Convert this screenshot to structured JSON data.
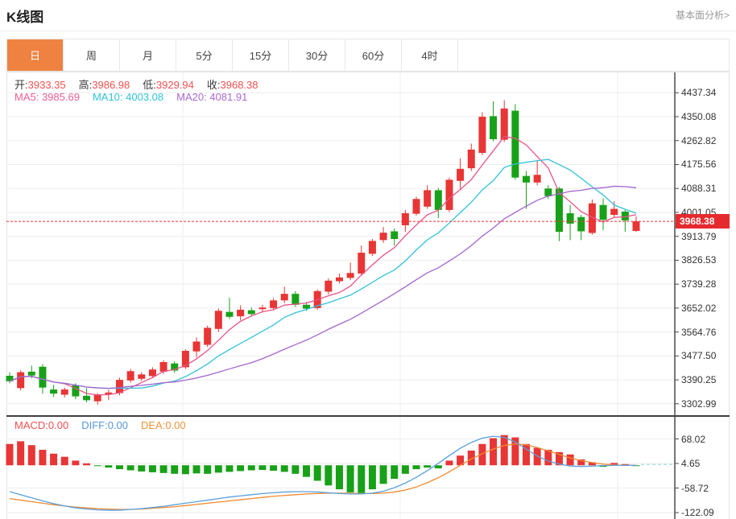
{
  "header": {
    "title": "K线图",
    "analysis_link": "基本面分析>"
  },
  "tabs": {
    "items": [
      "日",
      "周",
      "月",
      "5分",
      "15分",
      "30分",
      "60分",
      "4时"
    ],
    "active_index": 0,
    "active_label": "日"
  },
  "ohlc_legend": {
    "open_label": "开:",
    "open": "3933.35",
    "high_label": "高:",
    "high": "3986.98",
    "low_label": "低:",
    "low": "3929.94",
    "close_label": "收:",
    "close": "3968.38"
  },
  "ma_legend": {
    "ma5": "MA5: 3985.69",
    "ma10": "MA10: 4003.08",
    "ma20": "MA20: 4081.91"
  },
  "macd_legend": {
    "macd": "MACD:0.00",
    "diff": "DIFF:0.00",
    "dea": "DEA:0.00"
  },
  "price_axis": {
    "labels": [
      "4437.34",
      "4350.08",
      "4262.82",
      "4175.56",
      "4088.31",
      "4001.05",
      "3913.79",
      "3826.53",
      "3739.28",
      "3652.02",
      "3564.76",
      "3477.50",
      "3390.25",
      "3302.99"
    ],
    "current": "3968.38"
  },
  "macd_axis": {
    "labels": [
      "68.02",
      "4.65",
      "-58.72",
      "-122.09"
    ]
  },
  "colors": {
    "up": "#e83535",
    "down": "#18a118",
    "ma5": "#ea5288",
    "ma10": "#32c2da",
    "ma20": "#a565ce",
    "diff": "#59a0dc",
    "dea": "#f08a30",
    "grid": "#ededed",
    "axis": "#4a4a4a",
    "separator": "#3f3f3f",
    "price_line": "#f23030",
    "zero_dash": "#a5d9e8",
    "tab_active": "#ef8240",
    "badge": "#e52a2e"
  },
  "chart_data": {
    "type": "candlestick",
    "title": "K线图",
    "legend_position": "top-left",
    "grid": true,
    "price_axis_ticks": [
      4437.34,
      4350.08,
      4262.82,
      4175.56,
      4088.31,
      4001.05,
      3913.79,
      3826.53,
      3739.28,
      3652.02,
      3564.76,
      3477.5,
      3390.25,
      3302.99
    ],
    "current_price": 3968.38,
    "ohlc_latest": {
      "open": 3933.35,
      "high": 3986.98,
      "low": 3929.94,
      "close": 3968.38
    },
    "ma_latest": {
      "MA5": 3985.69,
      "MA10": 4003.08,
      "MA20": 4081.91
    },
    "candles": [
      [
        3405,
        3418,
        3378,
        3385
      ],
      [
        3360,
        3425,
        3352,
        3418
      ],
      [
        3420,
        3442,
        3396,
        3406
      ],
      [
        3438,
        3448,
        3340,
        3362
      ],
      [
        3355,
        3372,
        3328,
        3340
      ],
      [
        3336,
        3362,
        3326,
        3355
      ],
      [
        3370,
        3378,
        3320,
        3330
      ],
      [
        3332,
        3360,
        3308,
        3316
      ],
      [
        3312,
        3342,
        3300,
        3336
      ],
      [
        3338,
        3354,
        3316,
        3344
      ],
      [
        3342,
        3398,
        3334,
        3390
      ],
      [
        3388,
        3430,
        3380,
        3422
      ],
      [
        3394,
        3418,
        3386,
        3410
      ],
      [
        3404,
        3436,
        3396,
        3428
      ],
      [
        3420,
        3462,
        3412,
        3455
      ],
      [
        3450,
        3458,
        3416,
        3424
      ],
      [
        3436,
        3502,
        3430,
        3496
      ],
      [
        3494,
        3545,
        3472,
        3530
      ],
      [
        3518,
        3588,
        3510,
        3580
      ],
      [
        3576,
        3650,
        3564,
        3642
      ],
      [
        3638,
        3690,
        3612,
        3620
      ],
      [
        3622,
        3662,
        3608,
        3646
      ],
      [
        3644,
        3654,
        3622,
        3630
      ],
      [
        3648,
        3664,
        3636,
        3654
      ],
      [
        3652,
        3688,
        3644,
        3680
      ],
      [
        3680,
        3730,
        3670,
        3704
      ],
      [
        3704,
        3714,
        3656,
        3664
      ],
      [
        3664,
        3674,
        3642,
        3650
      ],
      [
        3652,
        3720,
        3646,
        3714
      ],
      [
        3712,
        3760,
        3702,
        3752
      ],
      [
        3750,
        3778,
        3742,
        3764
      ],
      [
        3762,
        3818,
        3754,
        3780
      ],
      [
        3778,
        3880,
        3770,
        3854
      ],
      [
        3850,
        3904,
        3842,
        3897
      ],
      [
        3900,
        3948,
        3890,
        3927
      ],
      [
        3932,
        3942,
        3880,
        3904
      ],
      [
        3954,
        4010,
        3930,
        3998
      ],
      [
        3996,
        4058,
        3990,
        4050
      ],
      [
        4022,
        4100,
        4014,
        4082
      ],
      [
        4082,
        4090,
        3980,
        4010
      ],
      [
        4010,
        4128,
        4002,
        4120
      ],
      [
        4116,
        4198,
        4086,
        4160
      ],
      [
        4162,
        4252,
        4152,
        4230
      ],
      [
        4218,
        4366,
        4210,
        4350
      ],
      [
        4352,
        4406,
        4260,
        4268
      ],
      [
        4266,
        4410,
        4258,
        4380
      ],
      [
        4372,
        4396,
        4120,
        4128
      ],
      [
        4134,
        4152,
        4014,
        4110
      ],
      [
        4110,
        4192,
        4100,
        4138
      ],
      [
        4088,
        4100,
        4050,
        4060
      ],
      [
        4088,
        4094,
        3896,
        3930
      ],
      [
        3998,
        4028,
        3900,
        3960
      ],
      [
        3984,
        3992,
        3900,
        3932
      ],
      [
        3926,
        4048,
        3920,
        4034
      ],
      [
        4028,
        4052,
        3936,
        3974
      ],
      [
        3992,
        4042,
        3984,
        4014
      ],
      [
        4004,
        4010,
        3930,
        3972
      ],
      [
        3933.35,
        3986.98,
        3929.94,
        3968.38
      ]
    ],
    "ma_periods": [
      5,
      10,
      20
    ],
    "macd": {
      "latest": {
        "MACD": 0.0,
        "DIFF": 0.0,
        "DEA": 0.0
      },
      "axis_ticks": [
        68.02,
        4.65,
        -58.72,
        -122.09
      ],
      "histogram": [
        55,
        62,
        52,
        40,
        30,
        22,
        12,
        5,
        -2,
        -6,
        -10,
        -13,
        -16,
        -18,
        -20,
        -22,
        -23,
        -21,
        -22,
        -19,
        -17,
        -15,
        -13,
        -12,
        -14,
        -17,
        -22,
        -30,
        -40,
        -52,
        -62,
        -70,
        -72,
        -62,
        -48,
        -35,
        -22,
        -10,
        -6,
        -8,
        12,
        25,
        38,
        55,
        70,
        78,
        72,
        55,
        45,
        40,
        34,
        28,
        15,
        8,
        -4,
        6,
        3,
        -2
      ],
      "diff": [
        -68,
        -76,
        -84,
        -92,
        -99,
        -105,
        -110,
        -113,
        -115,
        -116,
        -116,
        -114,
        -112,
        -109,
        -106,
        -102,
        -98,
        -94,
        -90,
        -86,
        -82,
        -79,
        -76,
        -73,
        -71,
        -69,
        -68,
        -68,
        -69,
        -71,
        -73,
        -74,
        -74,
        -72,
        -67,
        -58,
        -46,
        -31,
        -14,
        5,
        25,
        44,
        59,
        70,
        75,
        72,
        60,
        42,
        24,
        11,
        3,
        -2,
        -3,
        -2,
        -1,
        0,
        0,
        0
      ],
      "dea": [
        -86,
        -90,
        -94,
        -98,
        -102,
        -105,
        -108,
        -110,
        -112,
        -113,
        -114,
        -114,
        -113,
        -111,
        -109,
        -107,
        -104,
        -101,
        -98,
        -95,
        -92,
        -89,
        -86,
        -83,
        -80,
        -78,
        -76,
        -74,
        -73,
        -72,
        -72,
        -72,
        -73,
        -73,
        -72,
        -69,
        -64,
        -56,
        -45,
        -32,
        -17,
        0,
        16,
        30,
        42,
        51,
        55,
        53,
        46,
        37,
        28,
        19,
        12,
        7,
        3,
        1,
        0,
        0
      ]
    }
  }
}
